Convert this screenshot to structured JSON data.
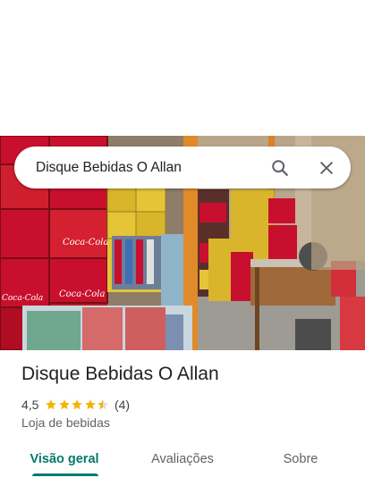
{
  "search": {
    "query": "Disque Bebidas O Allan",
    "search_icon": "search-icon",
    "close_icon": "close-icon"
  },
  "place": {
    "name": "Disque Bebidas O Allan",
    "rating": "4,5",
    "stars": 4.5,
    "reviews": "(4)",
    "category": "Loja de bebidas"
  },
  "tabs": [
    {
      "label": "Visão geral",
      "active": true
    },
    {
      "label": "Avaliações",
      "active": false
    },
    {
      "label": "Sobre",
      "active": false
    }
  ],
  "colors": {
    "accent": "#00796b",
    "star": "#f4b400",
    "coca_cola_red": "#c8102e"
  }
}
